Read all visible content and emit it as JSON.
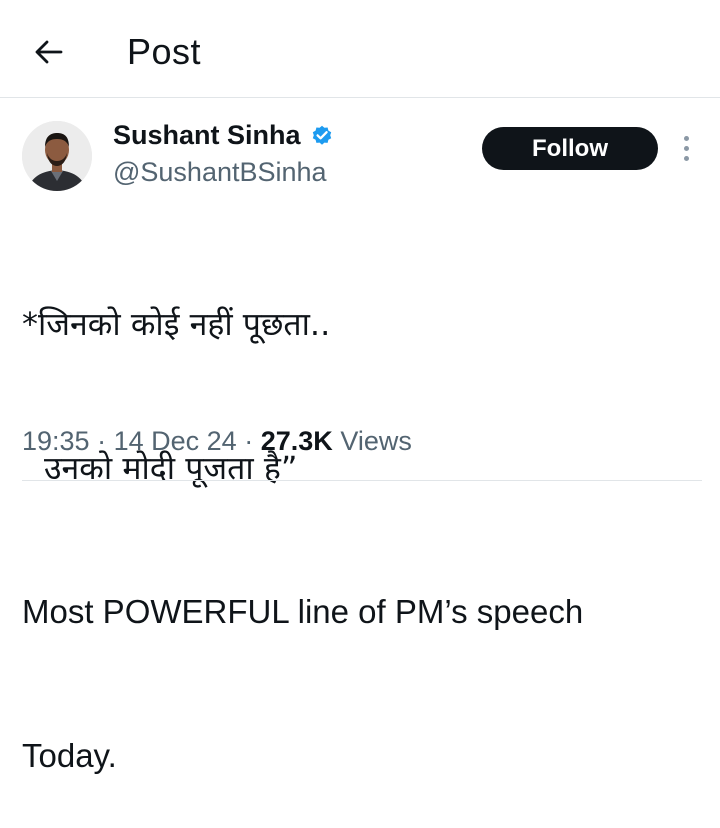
{
  "header": {
    "title": "Post",
    "back_icon": "arrow-left-icon"
  },
  "author": {
    "display_name": "Sushant Sinha",
    "handle": "@SushantBSinha",
    "verified": true,
    "verified_color": "#1d9bf0"
  },
  "follow_button": {
    "label": "Follow",
    "background": "#0f1419"
  },
  "tweet": {
    "lines": [
      "*जिनको कोई नहीं पूछता..",
      "उनको मोदी पूजता है”",
      "Most POWERFUL line of PM’s speech",
      "Today."
    ]
  },
  "meta": {
    "time": "19:35",
    "separator": "·",
    "date": "14 Dec 24",
    "views_count": "27.3K",
    "views_label": "Views"
  },
  "colors": {
    "text_primary": "#0f1419",
    "text_secondary": "#536471",
    "divider": "#e1e5e8"
  }
}
